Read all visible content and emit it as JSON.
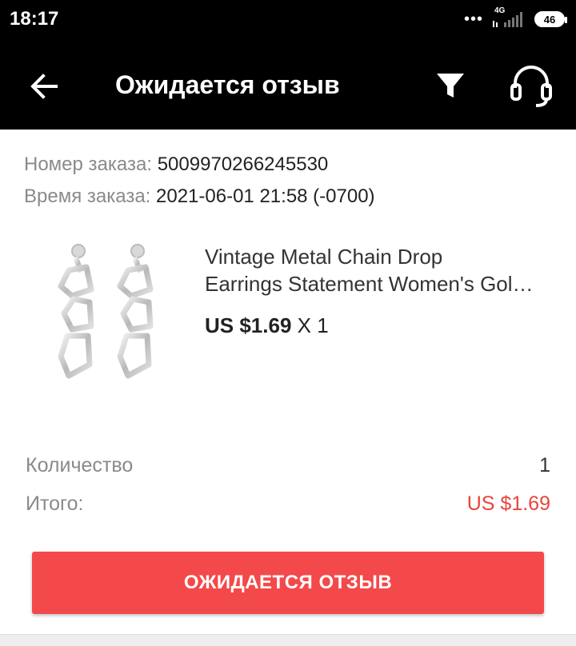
{
  "status_bar": {
    "time": "18:17",
    "dots": "•••",
    "network": "4G",
    "battery": "46"
  },
  "app_bar": {
    "title": "Ожидается отзыв",
    "icons": [
      "back-arrow-icon",
      "filter-icon",
      "headset-icon"
    ]
  },
  "order": {
    "number_label": "Номер заказа:",
    "number_value": "5009970266245530",
    "time_label": "Время заказа:",
    "time_value": "2021-06-01 21:58 (-0700)"
  },
  "product": {
    "name_line1": "Vintage Metal Chain Drop",
    "name_line2": "Earrings Statement Women's Gol…",
    "price": "US $1.69",
    "qty_text": "X 1"
  },
  "summary": {
    "quantity_label": "Количество",
    "quantity_value": "1",
    "total_label": "Итого:",
    "total_value": "US $1.69"
  },
  "cta": {
    "label": "ОЖИДАЕТСЯ ОТЗЫВ"
  },
  "colors": {
    "accent_red": "#f4494a",
    "total_red": "#e8453c"
  }
}
